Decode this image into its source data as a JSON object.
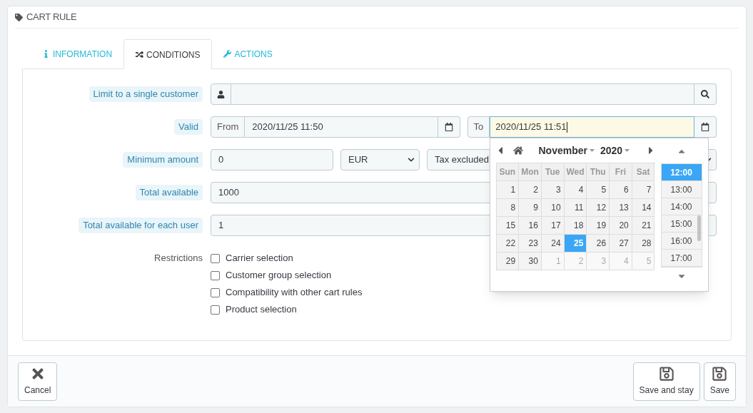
{
  "panel": {
    "title": "CART RULE"
  },
  "tabs": [
    {
      "label": "INFORMATION",
      "kind": "info",
      "selected": false
    },
    {
      "label": "CONDITIONS",
      "kind": "shuffle",
      "selected": true
    },
    {
      "label": "ACTIONS",
      "kind": "wrench",
      "selected": false
    }
  ],
  "rows": [
    {
      "kind": "customer",
      "label": "Limit to a single customer"
    },
    {
      "kind": "date-range",
      "label": "Valid",
      "from_label": "From",
      "from_value": "2020/11/25 11:50",
      "to_label": "To",
      "to_value": "2020/11/25 11:51"
    },
    {
      "kind": "amount",
      "label": "Minimum amount",
      "value": "0",
      "currency": "EUR",
      "tax": "Tax excluded"
    },
    {
      "kind": "text",
      "label": "Total available",
      "value": "1000"
    },
    {
      "kind": "text",
      "label": "Total available for each user",
      "value": "1"
    },
    {
      "kind": "checkboxes",
      "label": "Restrictions",
      "options": [
        {
          "label": "Carrier selection",
          "checked": false
        },
        {
          "label": "Customer group selection",
          "checked": false
        },
        {
          "label": "Compatibility with other cart rules",
          "checked": false
        },
        {
          "label": "Product selection",
          "checked": false
        }
      ]
    }
  ],
  "datepicker": {
    "month": "November",
    "year": "2020",
    "weekdays": [
      "Sun",
      "Mon",
      "Tue",
      "Wed",
      "Thu",
      "Fri",
      "Sat"
    ],
    "weeks": [
      [
        {
          "day": "1",
          "other_month": false,
          "selected": false
        },
        {
          "day": "2",
          "other_month": false,
          "selected": false
        },
        {
          "day": "3",
          "other_month": false,
          "selected": false
        },
        {
          "day": "4",
          "other_month": false,
          "selected": false
        },
        {
          "day": "5",
          "other_month": false,
          "selected": false
        },
        {
          "day": "6",
          "other_month": false,
          "selected": false
        },
        {
          "day": "7",
          "other_month": false,
          "selected": false
        }
      ],
      [
        {
          "day": "8",
          "other_month": false,
          "selected": false
        },
        {
          "day": "9",
          "other_month": false,
          "selected": false
        },
        {
          "day": "10",
          "other_month": false,
          "selected": false
        },
        {
          "day": "11",
          "other_month": false,
          "selected": false
        },
        {
          "day": "12",
          "other_month": false,
          "selected": false
        },
        {
          "day": "13",
          "other_month": false,
          "selected": false
        },
        {
          "day": "14",
          "other_month": false,
          "selected": false
        }
      ],
      [
        {
          "day": "15",
          "other_month": false,
          "selected": false
        },
        {
          "day": "16",
          "other_month": false,
          "selected": false
        },
        {
          "day": "17",
          "other_month": false,
          "selected": false
        },
        {
          "day": "18",
          "other_month": false,
          "selected": false
        },
        {
          "day": "19",
          "other_month": false,
          "selected": false
        },
        {
          "day": "20",
          "other_month": false,
          "selected": false
        },
        {
          "day": "21",
          "other_month": false,
          "selected": false
        }
      ],
      [
        {
          "day": "22",
          "other_month": false,
          "selected": false
        },
        {
          "day": "23",
          "other_month": false,
          "selected": false
        },
        {
          "day": "24",
          "other_month": false,
          "selected": false
        },
        {
          "day": "25",
          "other_month": false,
          "selected": true
        },
        {
          "day": "26",
          "other_month": false,
          "selected": false
        },
        {
          "day": "27",
          "other_month": false,
          "selected": false
        },
        {
          "day": "28",
          "other_month": false,
          "selected": false
        }
      ],
      [
        {
          "day": "29",
          "other_month": false,
          "selected": false
        },
        {
          "day": "30",
          "other_month": false,
          "selected": false
        },
        {
          "day": "1",
          "other_month": true,
          "selected": false
        },
        {
          "day": "2",
          "other_month": true,
          "selected": false
        },
        {
          "day": "3",
          "other_month": true,
          "selected": false
        },
        {
          "day": "4",
          "other_month": true,
          "selected": false
        },
        {
          "day": "5",
          "other_month": true,
          "selected": false
        }
      ]
    ],
    "times": [
      {
        "label": "12:00",
        "selected": true
      },
      {
        "label": "13:00",
        "selected": false
      },
      {
        "label": "14:00",
        "selected": false
      },
      {
        "label": "15:00",
        "selected": false
      },
      {
        "label": "16:00",
        "selected": false
      },
      {
        "label": "17:00",
        "selected": false
      }
    ]
  },
  "footer": {
    "left": [
      {
        "label": "Cancel",
        "kind": "close"
      }
    ],
    "right": [
      {
        "label": "Save and stay",
        "kind": "save"
      },
      {
        "label": "Save",
        "kind": "save"
      }
    ]
  }
}
